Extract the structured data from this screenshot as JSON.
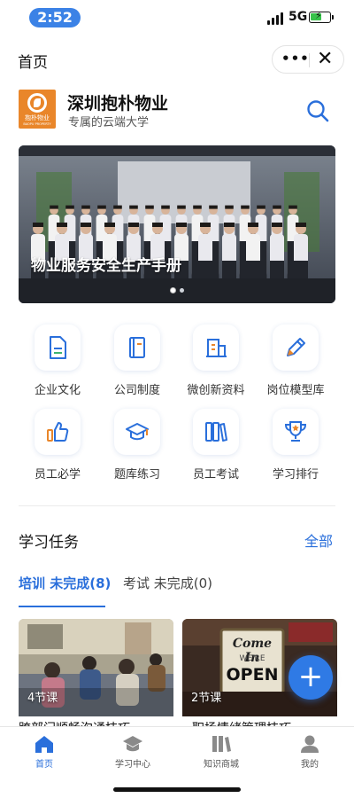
{
  "status_bar": {
    "time": "2:52",
    "network": "5G"
  },
  "nav": {
    "title": "首页",
    "more_icon": "more-dots-icon",
    "close_icon": "close-icon"
  },
  "header": {
    "logo_text": "抱朴物业",
    "logo_subtext": "BAOPU PROPERTY",
    "brand": "深圳抱朴物业",
    "tagline": "专属的云端大学",
    "search_icon": "search-icon"
  },
  "banner": {
    "caption": "物业服务安全生产手册",
    "page_count": 2,
    "active_page": 1
  },
  "grid": [
    {
      "label": "企业文化",
      "icon": "document-icon"
    },
    {
      "label": "公司制度",
      "icon": "book-icon"
    },
    {
      "label": "微创新资料",
      "icon": "building-icon"
    },
    {
      "label": "岗位模型库",
      "icon": "pencil-icon"
    },
    {
      "label": "员工必学",
      "icon": "thumbs-up-icon"
    },
    {
      "label": "题库练习",
      "icon": "graduation-cap-icon"
    },
    {
      "label": "员工考试",
      "icon": "books-icon"
    },
    {
      "label": "学习排行",
      "icon": "trophy-icon"
    }
  ],
  "tasks": {
    "title": "学习任务",
    "all_link": "全部",
    "tabs": [
      {
        "label": "培训 未完成(8)",
        "active": true
      },
      {
        "label": "考试 未完成(0)",
        "active": false
      }
    ],
    "cards": [
      {
        "lessons": "4节课",
        "title": "跨部门顺畅沟通技巧"
      },
      {
        "lessons": "2节课",
        "title": "职场情绪管理技巧"
      }
    ],
    "fab_icon": "plus-icon"
  },
  "tabbar": [
    {
      "label": "首页",
      "icon": "home-icon",
      "active": true
    },
    {
      "label": "学习中心",
      "icon": "graduation-cap-icon",
      "active": false
    },
    {
      "label": "知识商城",
      "icon": "books-icon",
      "active": false
    },
    {
      "label": "我的",
      "icon": "user-icon",
      "active": false
    }
  ],
  "colors": {
    "accent": "#2a6fdb",
    "brand_orange": "#e9862a",
    "status_pill": "#3b82e6",
    "battery_green": "#37c24a"
  }
}
